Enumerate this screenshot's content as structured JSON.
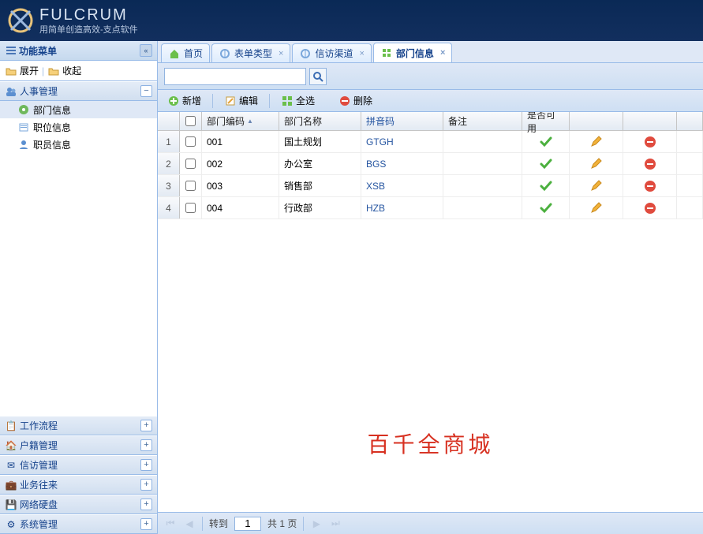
{
  "header": {
    "brand": "FULCRUM",
    "tagline": "用简单创造高效-支点软件"
  },
  "sidebar": {
    "title": "功能菜单",
    "expand_label": "展开",
    "collapse_label": "收起",
    "active_group": "人事管理",
    "tree": [
      {
        "label": "部门信息",
        "selected": true
      },
      {
        "label": "职位信息",
        "selected": false
      },
      {
        "label": "职员信息",
        "selected": false
      }
    ],
    "groups": [
      "工作流程",
      "户籍管理",
      "信访管理",
      "业务往来",
      "网络硬盘",
      "系统管理"
    ]
  },
  "tabs": [
    {
      "label": "首页",
      "closable": false
    },
    {
      "label": "表单类型",
      "closable": true
    },
    {
      "label": "信访渠道",
      "closable": true
    },
    {
      "label": "部门信息",
      "closable": true,
      "active": true
    }
  ],
  "search": {
    "value": "",
    "placeholder": ""
  },
  "toolbar": {
    "add": "新增",
    "edit": "编辑",
    "selectall": "全选",
    "delete": "删除"
  },
  "grid": {
    "columns": {
      "code": "部门编码",
      "name": "部门名称",
      "pinyin": "拼音码",
      "note": "备注",
      "avail": "是否可用"
    },
    "rows": [
      {
        "num": 1,
        "code": "001",
        "name": "国土规划",
        "pinyin": "GTGH",
        "note": ""
      },
      {
        "num": 2,
        "code": "002",
        "name": "办公室",
        "pinyin": "BGS",
        "note": ""
      },
      {
        "num": 3,
        "code": "003",
        "name": "销售部",
        "pinyin": "XSB",
        "note": ""
      },
      {
        "num": 4,
        "code": "004",
        "name": "行政部",
        "pinyin": "HZB",
        "note": ""
      }
    ]
  },
  "paging": {
    "goto_label": "转到",
    "current": "1",
    "total_text": "共 1 页"
  },
  "watermark": "百千全商城"
}
